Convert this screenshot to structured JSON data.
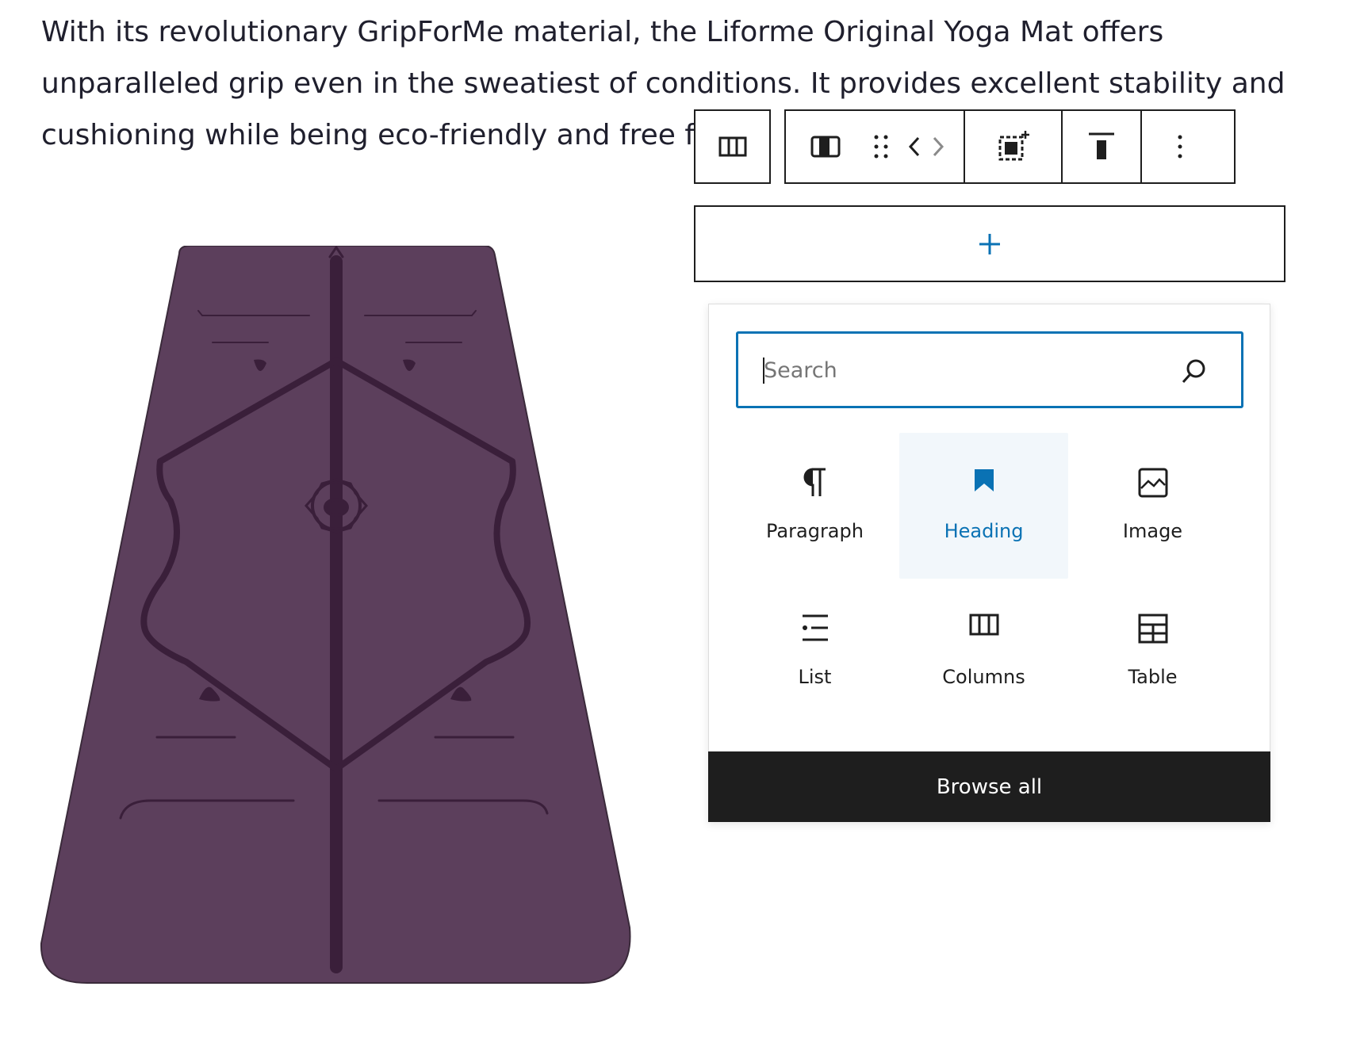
{
  "paragraph": {
    "lines": [
      "With its revolutionary GripForMe material, the Liforme Original Yoga Mat offers",
      "unparalleled grip even in the sweatiest of conditions. It provides excellent stability and",
      "cushioning while being eco-friendly and free fro"
    ]
  },
  "toolbar": {
    "buttons": [
      "columns-icon",
      "column-icon",
      "drag-handle-icon",
      "move-left-icon",
      "move-right-icon",
      "select-parent-icon",
      "align-top-icon",
      "more-options-icon"
    ]
  },
  "appender": {
    "icon": "plus-icon"
  },
  "inserter": {
    "search": {
      "placeholder": "Search",
      "value": ""
    },
    "blocks": [
      {
        "label": "Paragraph",
        "icon": "paragraph-icon"
      },
      {
        "label": "Heading",
        "icon": "heading-icon"
      },
      {
        "label": "Image",
        "icon": "image-icon"
      },
      {
        "label": "List",
        "icon": "list-icon"
      },
      {
        "label": "Columns",
        "icon": "columns-icon"
      },
      {
        "label": "Table",
        "icon": "table-icon"
      }
    ],
    "browse_all": "Browse all"
  },
  "colors": {
    "accent": "#0a72b4",
    "mat": "#5c3f5c",
    "mat_lines": "#3a1f3a",
    "dark": "#1e1e1e"
  }
}
